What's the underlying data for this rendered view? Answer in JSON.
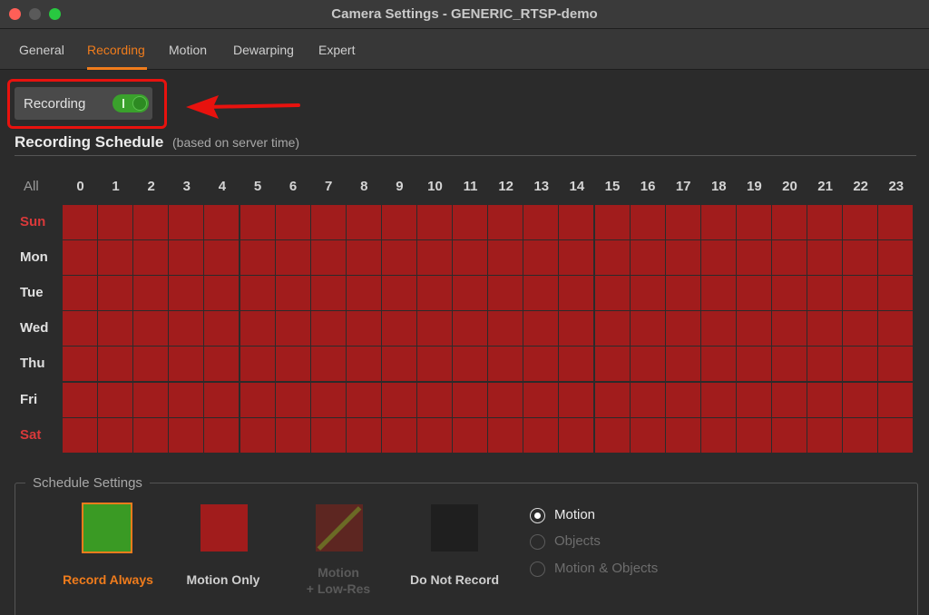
{
  "window": {
    "title": "Camera Settings - GENERIC_RTSP-demo"
  },
  "tabs": [
    {
      "label": "General",
      "active": false
    },
    {
      "label": "Recording",
      "active": true
    },
    {
      "label": "Motion",
      "active": false
    },
    {
      "label": "Dewarping",
      "active": false
    },
    {
      "label": "Expert",
      "active": false
    }
  ],
  "recording_toggle": {
    "label": "Recording",
    "on": true,
    "annotation_color": "#e8120e"
  },
  "schedule": {
    "title": "Recording Schedule",
    "subtitle": "(based on server time)",
    "all_label": "All",
    "hours": [
      "0",
      "1",
      "2",
      "3",
      "4",
      "5",
      "6",
      "7",
      "8",
      "9",
      "10",
      "11",
      "12",
      "13",
      "14",
      "15",
      "16",
      "17",
      "18",
      "19",
      "20",
      "21",
      "22",
      "23"
    ],
    "days": [
      "Sun",
      "Mon",
      "Tue",
      "Wed",
      "Thu",
      "Fri",
      "Sat"
    ],
    "cell_mode": "Motion Only",
    "cell_color": "#a11c1c"
  },
  "schedule_settings": {
    "legend": "Schedule Settings",
    "modes": [
      {
        "label": "Record Always",
        "color": "#3a9a24",
        "selected": true
      },
      {
        "label": "Motion Only",
        "color": "#a11c1c",
        "selected": false
      },
      {
        "label_line1": "Motion",
        "label_line2": "+ Low-Res",
        "color": "#5d2621",
        "disabled": true
      },
      {
        "label": "Do Not Record",
        "color": "#1f1f1f",
        "selected": false
      }
    ],
    "detection": [
      {
        "label": "Motion",
        "checked": true,
        "enabled": true
      },
      {
        "label": "Objects",
        "checked": false,
        "enabled": false
      },
      {
        "label": "Motion & Objects",
        "checked": false,
        "enabled": false
      }
    ]
  },
  "accent_color": "#f07c1c"
}
